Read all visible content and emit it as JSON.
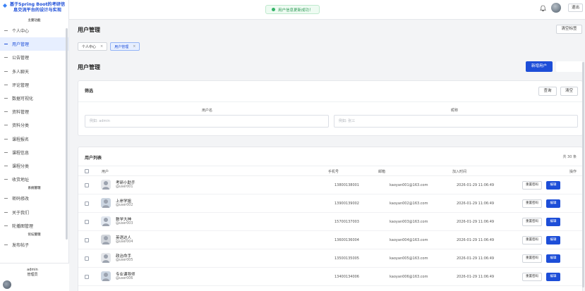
{
  "brand": {
    "title": "基于Spring Boot的考研信息交流平台的设计与实现"
  },
  "sidebar": {
    "section_main": "主要功能",
    "items_a": [
      {
        "label": "个人中心",
        "active": false
      },
      {
        "label": "用户管理",
        "active": true
      },
      {
        "label": "公告管理",
        "active": false
      },
      {
        "label": "多人聊天",
        "active": false
      },
      {
        "label": "评论管理",
        "active": false
      },
      {
        "label": "数据可视化",
        "active": false
      },
      {
        "label": "资料管理",
        "active": false
      },
      {
        "label": "资料分类",
        "active": false
      },
      {
        "label": "课程报名",
        "active": false
      },
      {
        "label": "课程信息",
        "active": false
      },
      {
        "label": "课程分类",
        "active": false
      },
      {
        "label": "收货地址",
        "active": false
      }
    ],
    "section_system": "系统管理",
    "items_b": [
      {
        "label": "密码修改"
      },
      {
        "label": "关于我们"
      },
      {
        "label": "轮播图管理"
      }
    ],
    "section_forum": "论坛管理",
    "items_c": [
      {
        "label": "发布帖子"
      }
    ],
    "user": {
      "name": "admin",
      "role": "管理员"
    }
  },
  "header": {
    "toast": "用户信息更新成功！",
    "logout": "退出"
  },
  "main": {
    "page_title": "用户管理",
    "clear_tags": "清空标签",
    "tabs": [
      {
        "label": "个人中心",
        "active": false
      },
      {
        "label": "用户管理",
        "active": true
      }
    ],
    "section_title": "用户管理",
    "add_button": "新增用户",
    "filter": {
      "title": "筛选",
      "search_button": "查询",
      "reset_button": "清空",
      "username_label": "用户名",
      "username_placeholder": "例如: admin",
      "nickname_label": "昵称",
      "nickname_placeholder": "例如: 张三"
    },
    "list": {
      "title": "用户列表",
      "count": "共 30 条",
      "columns": {
        "user": "用户",
        "phone": "手机号",
        "email": "邮箱",
        "created": "加入时间",
        "actions": "操作"
      },
      "reset_label": "重置密码",
      "edit_label": "编辑",
      "rows": [
        {
          "name": "考研小助手",
          "id": "@user001",
          "phone": "13800138001",
          "email": "kaoyan001@163.com",
          "created": "2026-01-29 11:06:49"
        },
        {
          "name": "上岸学姐",
          "id": "@user002",
          "phone": "13900139002",
          "email": "kaoyan002@163.com",
          "created": "2026-01-29 11:06:49"
        },
        {
          "name": "数学大神",
          "id": "@user003",
          "phone": "15700137003",
          "email": "kaoyan003@163.com",
          "created": "2026-01-29 11:06:49"
        },
        {
          "name": "英语达人",
          "id": "@user004",
          "phone": "13600136004",
          "email": "kaoyan004@163.com",
          "created": "2026-01-29 11:06:49"
        },
        {
          "name": "政治命手",
          "id": "@user005",
          "phone": "13500135005",
          "email": "kaoyan005@163.com",
          "created": "2026-01-29 11:06:49"
        },
        {
          "name": "专业课导师",
          "id": "@user006",
          "phone": "13400134006",
          "email": "kaoyan006@163.com",
          "created": "2026-01-29 11:06:49"
        }
      ]
    }
  },
  "colors": {
    "accent": "#1d4ed8",
    "success": "#34b368"
  }
}
